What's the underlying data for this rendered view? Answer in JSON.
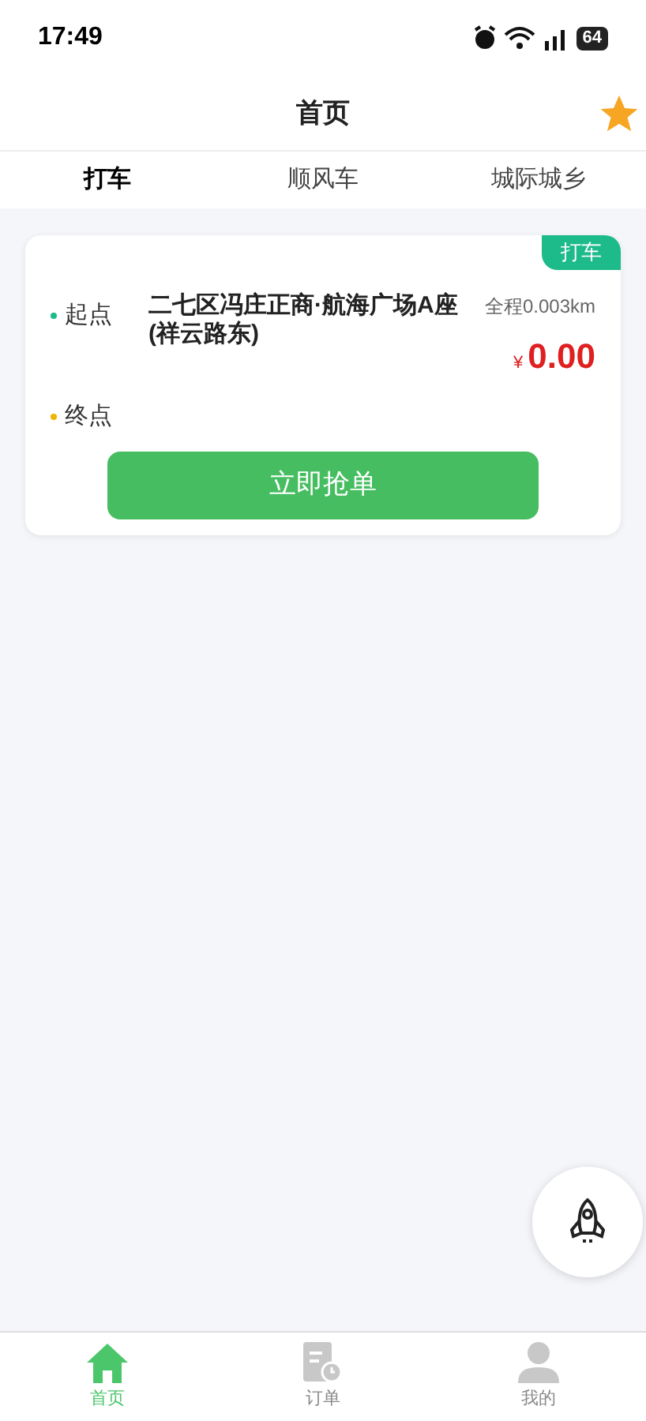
{
  "status_bar": {
    "time": "17:49",
    "battery": "64"
  },
  "header": {
    "title": "首页"
  },
  "tabs": [
    {
      "label": "打车",
      "selected": true
    },
    {
      "label": "顺风车",
      "selected": false
    },
    {
      "label": "城际城乡",
      "selected": false
    }
  ],
  "order": {
    "tag": "打车",
    "start_label": "起点",
    "start_address": "二七区冯庄正商·航海广场A座(祥云路东)",
    "end_label": "终点",
    "distance": "全程0.003km",
    "currency": "¥",
    "price": "0.00",
    "action": "立即抢单"
  },
  "bottom_nav": [
    {
      "kind": "home",
      "label": "首页",
      "selected": true
    },
    {
      "kind": "orders",
      "label": "订单",
      "selected": false
    },
    {
      "kind": "profile",
      "label": "我的",
      "selected": false
    }
  ]
}
